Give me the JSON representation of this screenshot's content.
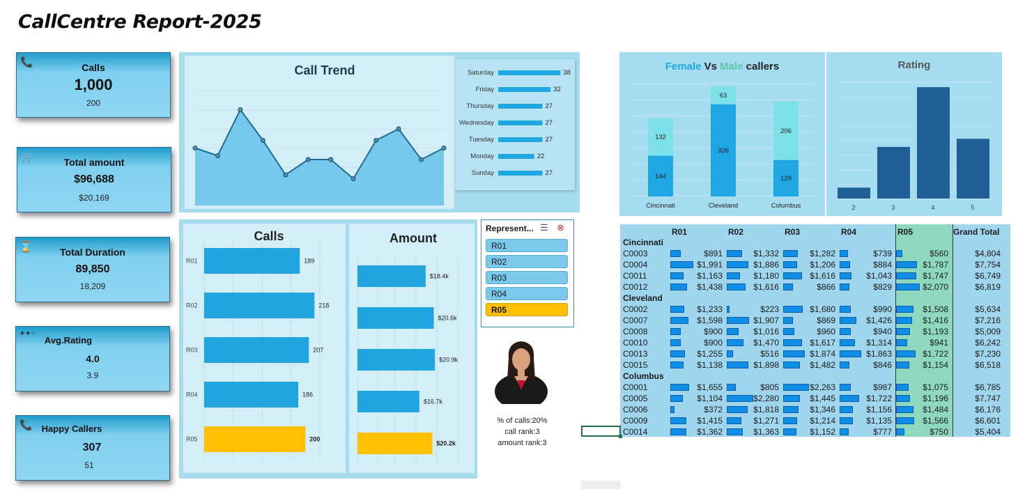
{
  "report_title": "CallCentre Report-2025",
  "kpis": [
    {
      "label": "Calls",
      "value": "1,000",
      "sub": "200",
      "icon": "phone-icon",
      "glyph": "📞"
    },
    {
      "label": "Total amount",
      "value": "$96,688",
      "sub": "$20,169",
      "icon": "cart-icon",
      "glyph": "🛒"
    },
    {
      "label": "Total Duration",
      "value": "89,850",
      "sub": "18,209",
      "icon": "hourglass-icon",
      "glyph": "⌛"
    },
    {
      "label": "Avg.Rating",
      "value": "4.0",
      "sub": "3.9",
      "icon": "stars-icon",
      "glyph": "★★☆"
    },
    {
      "label": "Happy Callers",
      "value": "307",
      "sub": "51",
      "icon": "phone-icon",
      "glyph": "📞"
    }
  ],
  "charts": {
    "call_trend": {
      "title": "Call Trend"
    },
    "calls_by_rep": {
      "title": "Calls"
    },
    "amount_by_rep": {
      "title": "Amount"
    },
    "gender": {
      "title_female": "Female",
      "title_vs": " Vs ",
      "title_male": "Male",
      "title_rest": " callers"
    },
    "rating": {
      "title": "Rating"
    }
  },
  "chart_data": [
    {
      "type": "area",
      "title": "Call Trend",
      "values": [
        30,
        28,
        40,
        32,
        23,
        27,
        27,
        22,
        32,
        35,
        27,
        30
      ],
      "ylim": [
        15,
        45
      ]
    },
    {
      "type": "bar",
      "orientation": "horizontal",
      "categories": [
        "Saturday",
        "Friday",
        "Thursday",
        "Wednesday",
        "Tuesday",
        "Monday",
        "Sunday"
      ],
      "values": [
        38,
        32,
        27,
        27,
        27,
        22,
        27
      ],
      "data_labels": [
        "38",
        "32",
        "27",
        "27",
        "27",
        "22",
        "27"
      ]
    },
    {
      "type": "bar",
      "orientation": "horizontal",
      "title": "Calls",
      "categories": [
        "R01",
        "R02",
        "R03",
        "R04",
        "R05"
      ],
      "values": [
        189,
        218,
        207,
        186,
        200
      ],
      "data_labels": [
        "189",
        "218",
        "207",
        "186",
        "200"
      ],
      "highlight": "R05",
      "highlight_color": "#ffc000",
      "color": "#20a4e0"
    },
    {
      "type": "bar",
      "orientation": "horizontal",
      "title": "Amount",
      "categories": [
        "R01",
        "R02",
        "R03",
        "R04",
        "R05"
      ],
      "values": [
        18.4,
        20.6,
        20.9,
        16.7,
        20.2
      ],
      "data_labels": [
        "$18.4k",
        "$20.6k",
        "$20.9k",
        "$16.7k",
        "$20.2k"
      ],
      "highlight": "R05",
      "highlight_color": "#ffc000",
      "color": "#20a4e0"
    },
    {
      "type": "bar",
      "stacked": true,
      "title": "Female Vs Male callers",
      "categories": [
        "Cincinnati",
        "Cleveland",
        "Columbus"
      ],
      "series": [
        {
          "values": [
            144,
            326,
            129
          ],
          "color": "#1ea7e3"
        },
        {
          "values": [
            132,
            63,
            206
          ],
          "color": "#7ee0e8"
        }
      ]
    },
    {
      "type": "bar",
      "title": "Rating",
      "categories": [
        "2",
        "3",
        "4",
        "5"
      ],
      "values": [
        20,
        95,
        205,
        110
      ],
      "color": "#1f5f96"
    }
  ],
  "slicer": {
    "header": "Represent...",
    "items": [
      "R01",
      "R02",
      "R03",
      "R04",
      "R05"
    ],
    "selected": "R05"
  },
  "rep_stats": {
    "pct_calls": "% of calls:20%",
    "call_rank": "call rank:3",
    "amount_rank": "amount rank:3"
  },
  "pivot": {
    "columns": [
      "R01",
      "R02",
      "R03",
      "R04",
      "R05",
      "Grand Total"
    ],
    "groups": [
      {
        "name": "Cincinnati",
        "rows": [
          {
            "id": "C0003",
            "vals": [
              "$891",
              "$1,332",
              "$1,282",
              "$739",
              "$560"
            ],
            "nums": [
              891,
              1332,
              1282,
              739,
              560
            ],
            "total": "$4,804"
          },
          {
            "id": "C0004",
            "vals": [
              "$1,991",
              "$1,886",
              "$1,206",
              "$884",
              "$1,787"
            ],
            "nums": [
              1991,
              1886,
              1206,
              884,
              1787
            ],
            "total": "$7,754"
          },
          {
            "id": "C0011",
            "vals": [
              "$1,163",
              "$1,180",
              "$1,616",
              "$1,043",
              "$1,747"
            ],
            "nums": [
              1163,
              1180,
              1616,
              1043,
              1747
            ],
            "total": "$6,749"
          },
          {
            "id": "C0012",
            "vals": [
              "$1,438",
              "$1,616",
              "$866",
              "$829",
              "$2,070"
            ],
            "nums": [
              1438,
              1616,
              866,
              829,
              2070
            ],
            "total": "$6,819"
          }
        ]
      },
      {
        "name": "Cleveland",
        "rows": [
          {
            "id": "C0002",
            "vals": [
              "$1,233",
              "$223",
              "$1,680",
              "$990",
              "$1,508"
            ],
            "nums": [
              1233,
              223,
              1680,
              990,
              1508
            ],
            "total": "$5,634"
          },
          {
            "id": "C0007",
            "vals": [
              "$1,598",
              "$1,907",
              "$869",
              "$1,426",
              "$1,416"
            ],
            "nums": [
              1598,
              1907,
              869,
              1426,
              1416
            ],
            "total": "$7,216"
          },
          {
            "id": "C0008",
            "vals": [
              "$900",
              "$1,016",
              "$960",
              "$940",
              "$1,193"
            ],
            "nums": [
              900,
              1016,
              960,
              940,
              1193
            ],
            "total": "$5,009"
          },
          {
            "id": "C0010",
            "vals": [
              "$900",
              "$1,470",
              "$1,617",
              "$1,314",
              "$941"
            ],
            "nums": [
              900,
              1470,
              1617,
              1314,
              941
            ],
            "total": "$6,242"
          },
          {
            "id": "C0013",
            "vals": [
              "$1,255",
              "$516",
              "$1,874",
              "$1,863",
              "$1,722"
            ],
            "nums": [
              1255,
              516,
              1874,
              1863,
              1722
            ],
            "total": "$7,230"
          },
          {
            "id": "C0015",
            "vals": [
              "$1,138",
              "$1,898",
              "$1,482",
              "$846",
              "$1,154"
            ],
            "nums": [
              1138,
              1898,
              1482,
              846,
              1154
            ],
            "total": "$6,518"
          }
        ]
      },
      {
        "name": "Columbus",
        "rows": [
          {
            "id": "C0001",
            "vals": [
              "$1,655",
              "$805",
              "$2,263",
              "$987",
              "$1,075"
            ],
            "nums": [
              1655,
              805,
              2263,
              987,
              1075
            ],
            "total": "$6,785"
          },
          {
            "id": "C0005",
            "vals": [
              "$1,104",
              "$2,280",
              "$1,445",
              "$1,722",
              "$1,196"
            ],
            "nums": [
              1104,
              2280,
              1445,
              1722,
              1196
            ],
            "total": "$7,747"
          },
          {
            "id": "C0006",
            "vals": [
              "$372",
              "$1,818",
              "$1,346",
              "$1,156",
              "$1,484"
            ],
            "nums": [
              372,
              1818,
              1346,
              1156,
              1484
            ],
            "total": "$6,176"
          },
          {
            "id": "C0009",
            "vals": [
              "$1,415",
              "$1,271",
              "$1,214",
              "$1,135",
              "$1,566"
            ],
            "nums": [
              1415,
              1271,
              1214,
              1135,
              1566
            ],
            "total": "$6,601"
          },
          {
            "id": "C0014",
            "vals": [
              "$1,362",
              "$1,363",
              "$1,152",
              "$777",
              "$750"
            ],
            "nums": [
              1362,
              1363,
              1152,
              777,
              750
            ],
            "total": "$5,404"
          }
        ]
      }
    ]
  }
}
